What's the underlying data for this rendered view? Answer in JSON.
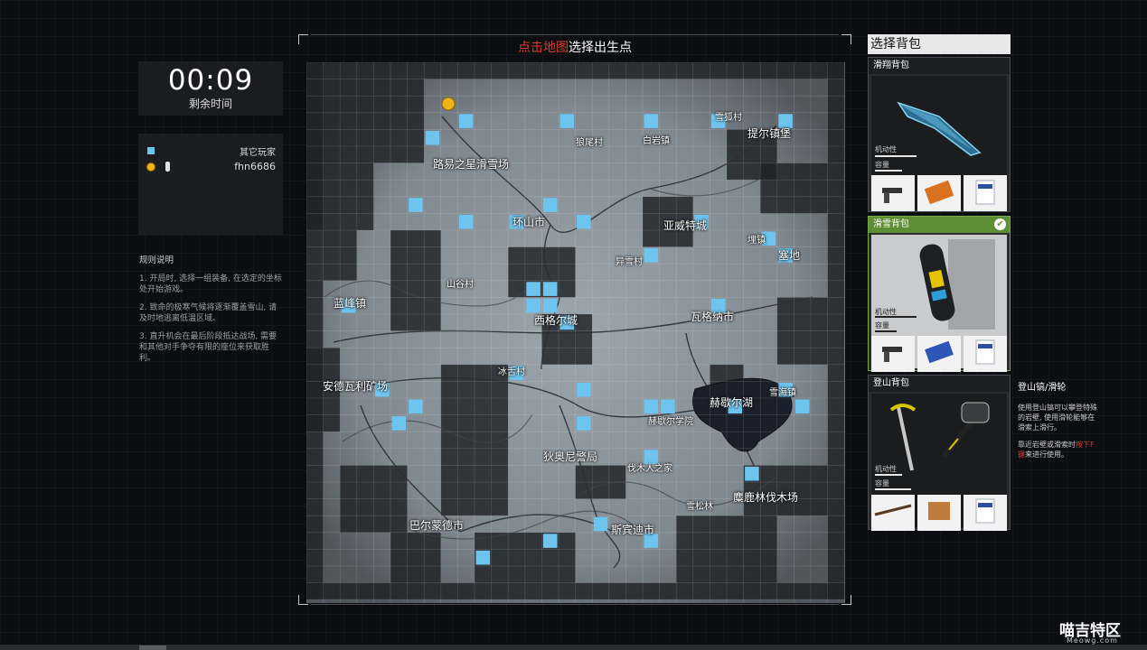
{
  "timer": {
    "value": "00:09",
    "label": "剩余时间"
  },
  "players": {
    "others_label": "其它玩家",
    "self_name": "fhn6686"
  },
  "rules": {
    "title": "规则说明",
    "items": [
      "1. 开局时, 选择一组装备, 在选定的坐标处开始游戏。",
      "2. 致命的极寒气候将逐渐覆盖雪山, 请及时地逃离低温区域。",
      "3. 直升机会在最后阶段抵达战场, 需要和其他对手争夺有限的座位来获取胜利。"
    ]
  },
  "map": {
    "title_red": "点击地图",
    "title_white": "选择出生点",
    "player_color": "#f1b418",
    "spawn_color": "#6cc4ef",
    "locations": [
      {
        "name": "路易之星滑雪场",
        "size": "big"
      },
      {
        "name": "狼尾村",
        "size": "small"
      },
      {
        "name": "白岩镇",
        "size": "small"
      },
      {
        "name": "雪狐村",
        "size": "small"
      },
      {
        "name": "提尔镇堡",
        "size": "big"
      },
      {
        "name": "环山市",
        "size": "big"
      },
      {
        "name": "亚威特城",
        "size": "big"
      },
      {
        "name": "埋镇",
        "size": "small"
      },
      {
        "name": "塞地",
        "size": "big"
      },
      {
        "name": "异雪村",
        "size": "small"
      },
      {
        "name": "山谷村",
        "size": "small"
      },
      {
        "name": "蓝峰镇",
        "size": "big"
      },
      {
        "name": "西格尔城",
        "size": "big"
      },
      {
        "name": "瓦格纳市",
        "size": "big"
      },
      {
        "name": "冰舌村",
        "size": "small"
      },
      {
        "name": "安德瓦利矿场",
        "size": "big"
      },
      {
        "name": "赫歇尔湖",
        "size": "big"
      },
      {
        "name": "雪海镇",
        "size": "small"
      },
      {
        "name": "赫歇尔学院",
        "size": "small"
      },
      {
        "name": "狄奥尼警局",
        "size": "big"
      },
      {
        "name": "伐木人之家",
        "size": "small"
      },
      {
        "name": "雪松林",
        "size": "small"
      },
      {
        "name": "麋鹿林伐木场",
        "size": "big"
      },
      {
        "name": "巴尔蒙德市",
        "size": "big"
      },
      {
        "name": "斯宾迪市",
        "size": "big"
      }
    ]
  },
  "backpacks": {
    "title": "选择背包",
    "stat_mobility": "机动性",
    "stat_capacity": "容量",
    "cards": [
      {
        "name": "滑翔背包",
        "selected": false,
        "item_icon": "glider-icon"
      },
      {
        "name": "滑雪背包",
        "selected": true,
        "item_icon": "snowboard-icon"
      },
      {
        "name": "登山背包",
        "selected": false,
        "item_icon": "ice-axe-icon"
      }
    ],
    "side_title": "登山镐/滑轮",
    "side_desc_1": "使用登山镐可以攀登特殊的岩壁, 使用滑轮能够在滑索上滑行。",
    "side_desc_2a": "靠近岩壁或滑索时",
    "side_desc_2b": "按下F键",
    "side_desc_2c": "来进行使用。"
  },
  "watermark": {
    "main": "喵吉特区",
    "sub": "Meowg.com"
  }
}
